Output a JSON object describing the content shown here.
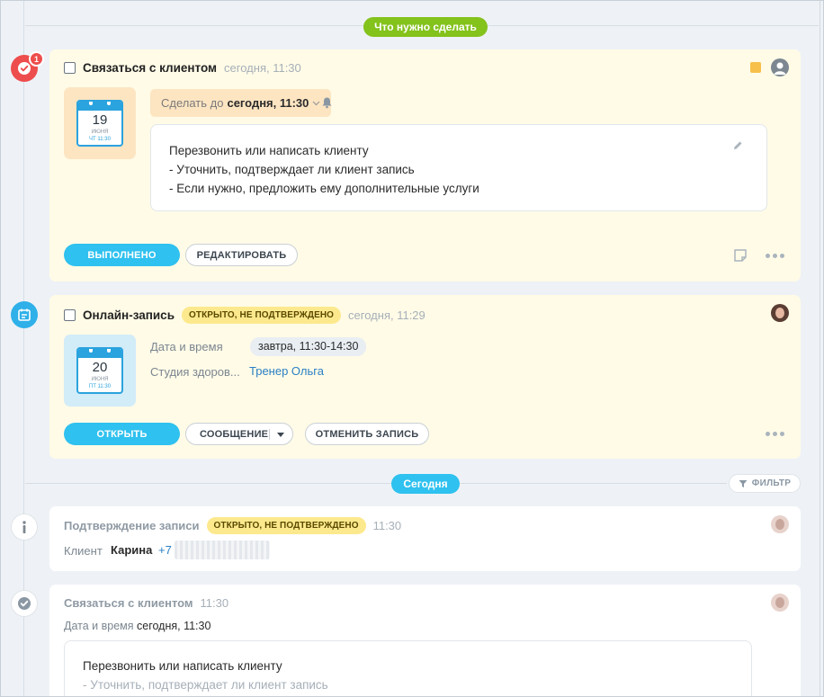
{
  "sections": {
    "todo_label": "Что нужно сделать",
    "today_label": "Сегодня",
    "filter_label": "ФИЛЬТР"
  },
  "task_card": {
    "badge_count": "1",
    "title": "Связаться с клиентом",
    "time": "сегодня, 11:30",
    "calendar": {
      "day": "19",
      "month": "июня",
      "sub": "ЧТ 11:30"
    },
    "due_prefix": "Сделать до",
    "due_value": "сегодня, 11:30",
    "note_lines": [
      "Перезвонить или написать клиенту",
      "- Уточнить, подтверждает ли клиент запись",
      "- Если нужно, предложить ему дополнительные услуги"
    ],
    "done_label": "ВЫПОЛНЕНО",
    "edit_label": "РЕДАКТИРОВАТЬ",
    "colors": {
      "marker": "#ee4d4d",
      "flag": "#f7c04a"
    }
  },
  "booking_card": {
    "title": "Онлайн-запись",
    "status": "ОТКРЫТО, НЕ ПОДТВЕРЖДЕНО",
    "time": "сегодня, 11:29",
    "calendar": {
      "day": "20",
      "month": "июня",
      "sub": "ПТ 11:30"
    },
    "datetime_label": "Дата и время",
    "datetime_value": "завтра, 11:30-14:30",
    "studio_label": "Студия здоров...",
    "trainer_value": "Тренер Ольга",
    "open_label": "ОТКРЫТЬ",
    "message_label": "СООБЩЕНИЕ",
    "cancel_label": "ОТМЕНИТЬ ЗАПИСЬ"
  },
  "confirm_card": {
    "title": "Подтверждение записи",
    "status": "ОТКРЫТО, НЕ ПОДТВЕРЖДЕНО",
    "time": "11:30",
    "client_label": "Клиент",
    "client_name": "Карина",
    "phone_prefix": "+7"
  },
  "contact_card": {
    "title": "Связаться с клиентом",
    "time": "11:30",
    "datetime_label": "Дата и время",
    "datetime_value": "сегодня, 11:30",
    "note_lines": [
      "Перезвонить или написать клиенту",
      "- Уточнить, подтверждает ли клиент запись"
    ]
  }
}
